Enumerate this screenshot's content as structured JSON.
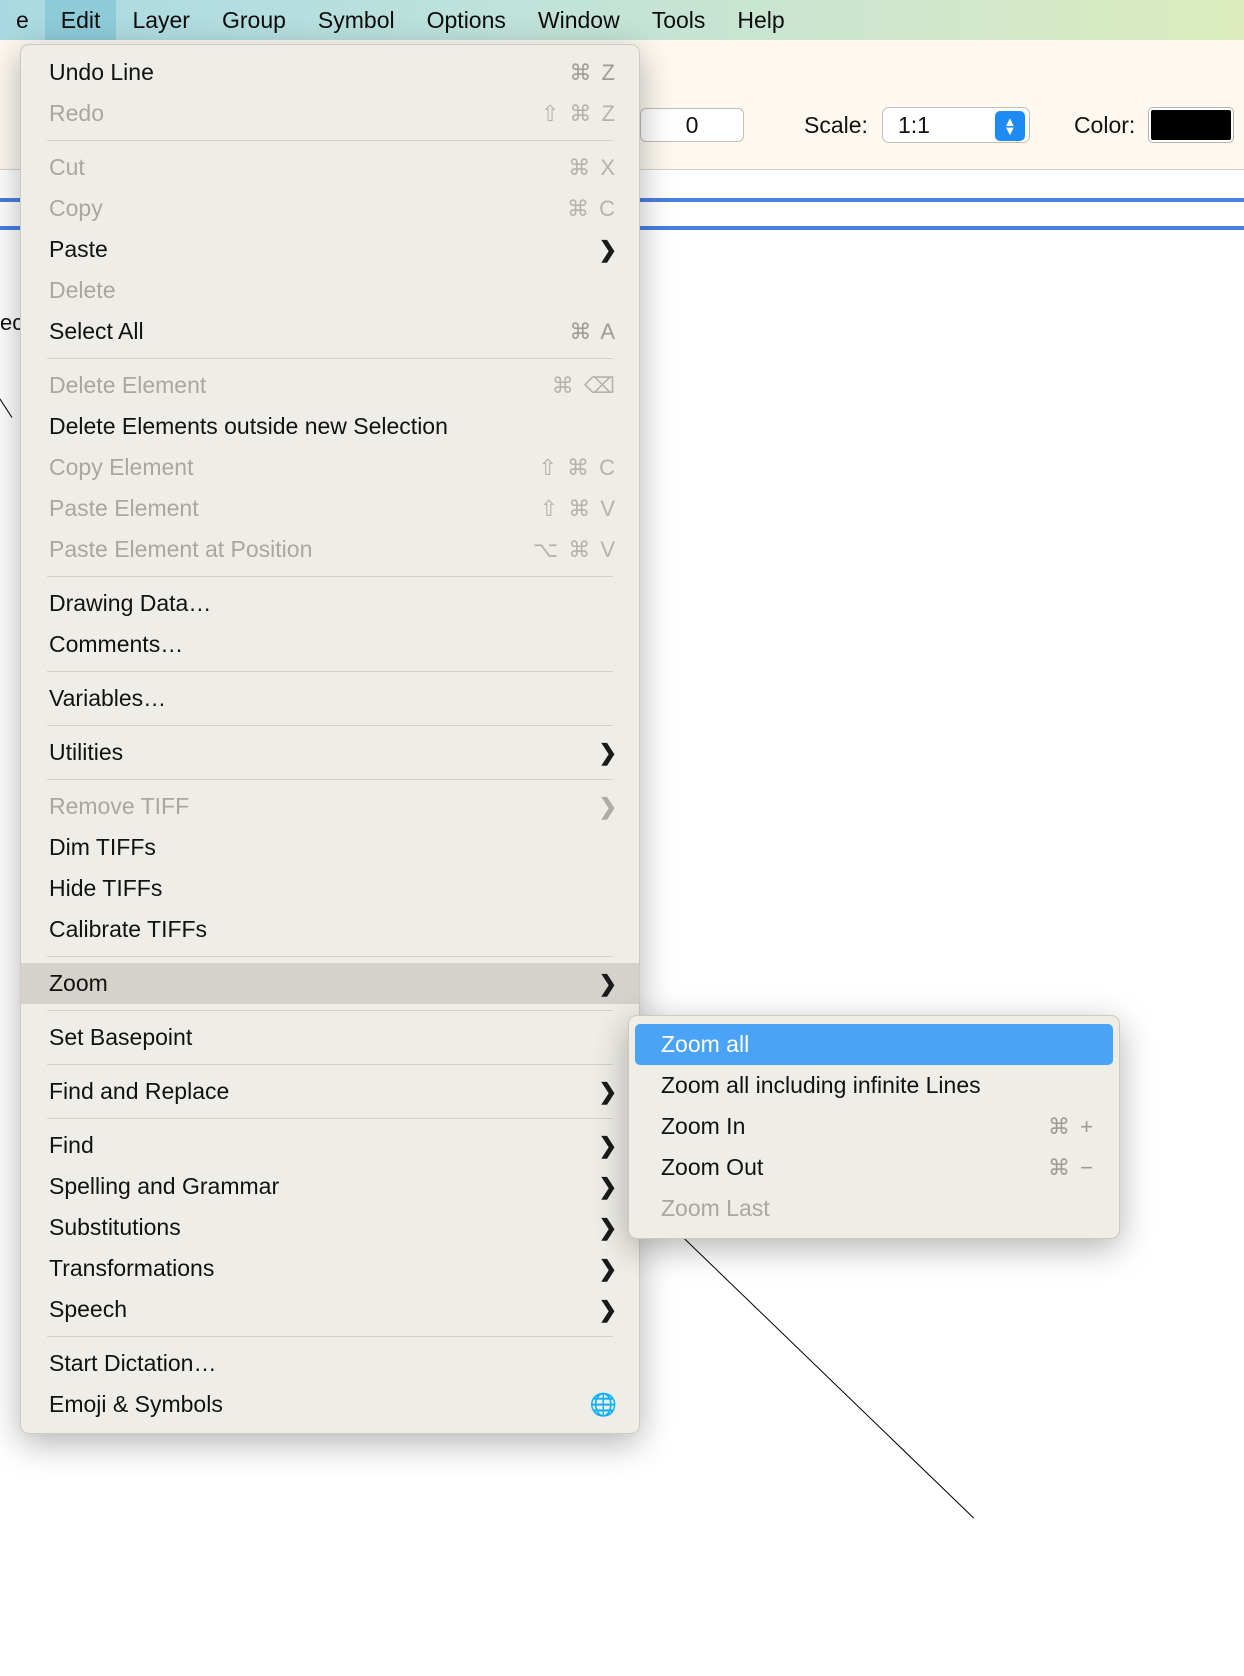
{
  "menubar": {
    "items": [
      {
        "label": "e",
        "selected": false
      },
      {
        "label": "Edit",
        "selected": true
      },
      {
        "label": "Layer",
        "selected": false
      },
      {
        "label": "Group",
        "selected": false
      },
      {
        "label": "Symbol",
        "selected": false
      },
      {
        "label": "Options",
        "selected": false
      },
      {
        "label": "Window",
        "selected": false
      },
      {
        "label": "Tools",
        "selected": false
      },
      {
        "label": "Help",
        "selected": false
      }
    ]
  },
  "toolbar": {
    "number_field_value": "0",
    "scale_label": "Scale:",
    "scale_value": "1:1",
    "color_label": "Color:",
    "color_value": "#000000",
    "accent_color": "#1e8bf5"
  },
  "canvas": {
    "left_label": "ect"
  },
  "edit_menu": {
    "items": [
      {
        "label": "Undo Line",
        "shortcut": "⌘ Z",
        "disabled": false,
        "submenu": false
      },
      {
        "label": "Redo",
        "shortcut": "⇧ ⌘ Z",
        "disabled": true,
        "submenu": false
      },
      {
        "separator": true
      },
      {
        "label": "Cut",
        "shortcut": "⌘ X",
        "disabled": true,
        "submenu": false
      },
      {
        "label": "Copy",
        "shortcut": "⌘ C",
        "disabled": true,
        "submenu": false
      },
      {
        "label": "Paste",
        "shortcut": "",
        "disabled": false,
        "submenu": true
      },
      {
        "label": "Delete",
        "shortcut": "",
        "disabled": true,
        "submenu": false
      },
      {
        "label": "Select All",
        "shortcut": "⌘ A",
        "disabled": false,
        "submenu": false
      },
      {
        "separator": true
      },
      {
        "label": "Delete Element",
        "shortcut": "⌘ ⌫",
        "disabled": true,
        "submenu": false
      },
      {
        "label": "Delete Elements outside new Selection",
        "shortcut": "",
        "disabled": false,
        "submenu": false
      },
      {
        "label": "Copy Element",
        "shortcut": "⇧ ⌘ C",
        "disabled": true,
        "submenu": false
      },
      {
        "label": "Paste Element",
        "shortcut": "⇧ ⌘ V",
        "disabled": true,
        "submenu": false
      },
      {
        "label": "Paste Element at Position",
        "shortcut": "⌥ ⌘ V",
        "disabled": true,
        "submenu": false
      },
      {
        "separator": true
      },
      {
        "label": "Drawing Data…",
        "shortcut": "",
        "disabled": false,
        "submenu": false
      },
      {
        "label": "Comments…",
        "shortcut": "",
        "disabled": false,
        "submenu": false
      },
      {
        "separator": true
      },
      {
        "label": "Variables…",
        "shortcut": "",
        "disabled": false,
        "submenu": false
      },
      {
        "separator": true
      },
      {
        "label": "Utilities",
        "shortcut": "",
        "disabled": false,
        "submenu": true
      },
      {
        "separator": true
      },
      {
        "label": "Remove TIFF",
        "shortcut": "",
        "disabled": true,
        "submenu": true
      },
      {
        "label": "Dim TIFFs",
        "shortcut": "",
        "disabled": false,
        "submenu": false
      },
      {
        "label": "Hide TIFFs",
        "shortcut": "",
        "disabled": false,
        "submenu": false
      },
      {
        "label": "Calibrate TIFFs",
        "shortcut": "",
        "disabled": false,
        "submenu": false
      },
      {
        "separator": true
      },
      {
        "label": "Zoom",
        "shortcut": "",
        "disabled": false,
        "submenu": true,
        "highlighted": true
      },
      {
        "separator": true
      },
      {
        "label": "Set Basepoint",
        "shortcut": "",
        "disabled": false,
        "submenu": false
      },
      {
        "separator": true
      },
      {
        "label": "Find and Replace",
        "shortcut": "",
        "disabled": false,
        "submenu": true
      },
      {
        "separator": true
      },
      {
        "label": "Find",
        "shortcut": "",
        "disabled": false,
        "submenu": true
      },
      {
        "label": "Spelling and Grammar",
        "shortcut": "",
        "disabled": false,
        "submenu": true
      },
      {
        "label": "Substitutions",
        "shortcut": "",
        "disabled": false,
        "submenu": true
      },
      {
        "label": "Transformations",
        "shortcut": "",
        "disabled": false,
        "submenu": true
      },
      {
        "label": "Speech",
        "shortcut": "",
        "disabled": false,
        "submenu": true
      },
      {
        "separator": true
      },
      {
        "label": "Start Dictation…",
        "shortcut": "",
        "disabled": false,
        "submenu": false
      },
      {
        "label": "Emoji & Symbols",
        "shortcut": "",
        "disabled": false,
        "submenu": false,
        "icon": "globe-icon"
      }
    ]
  },
  "zoom_submenu": {
    "items": [
      {
        "label": "Zoom all",
        "shortcut": "",
        "selected": true,
        "disabled": false
      },
      {
        "label": "Zoom all including infinite Lines",
        "shortcut": "",
        "selected": false,
        "disabled": false
      },
      {
        "label": "Zoom In",
        "shortcut": "⌘ +",
        "selected": false,
        "disabled": false
      },
      {
        "label": "Zoom Out",
        "shortcut": "⌘ −",
        "selected": false,
        "disabled": false
      },
      {
        "label": "Zoom Last",
        "shortcut": "",
        "selected": false,
        "disabled": true
      }
    ],
    "highlight_color": "#4aa3f7"
  }
}
